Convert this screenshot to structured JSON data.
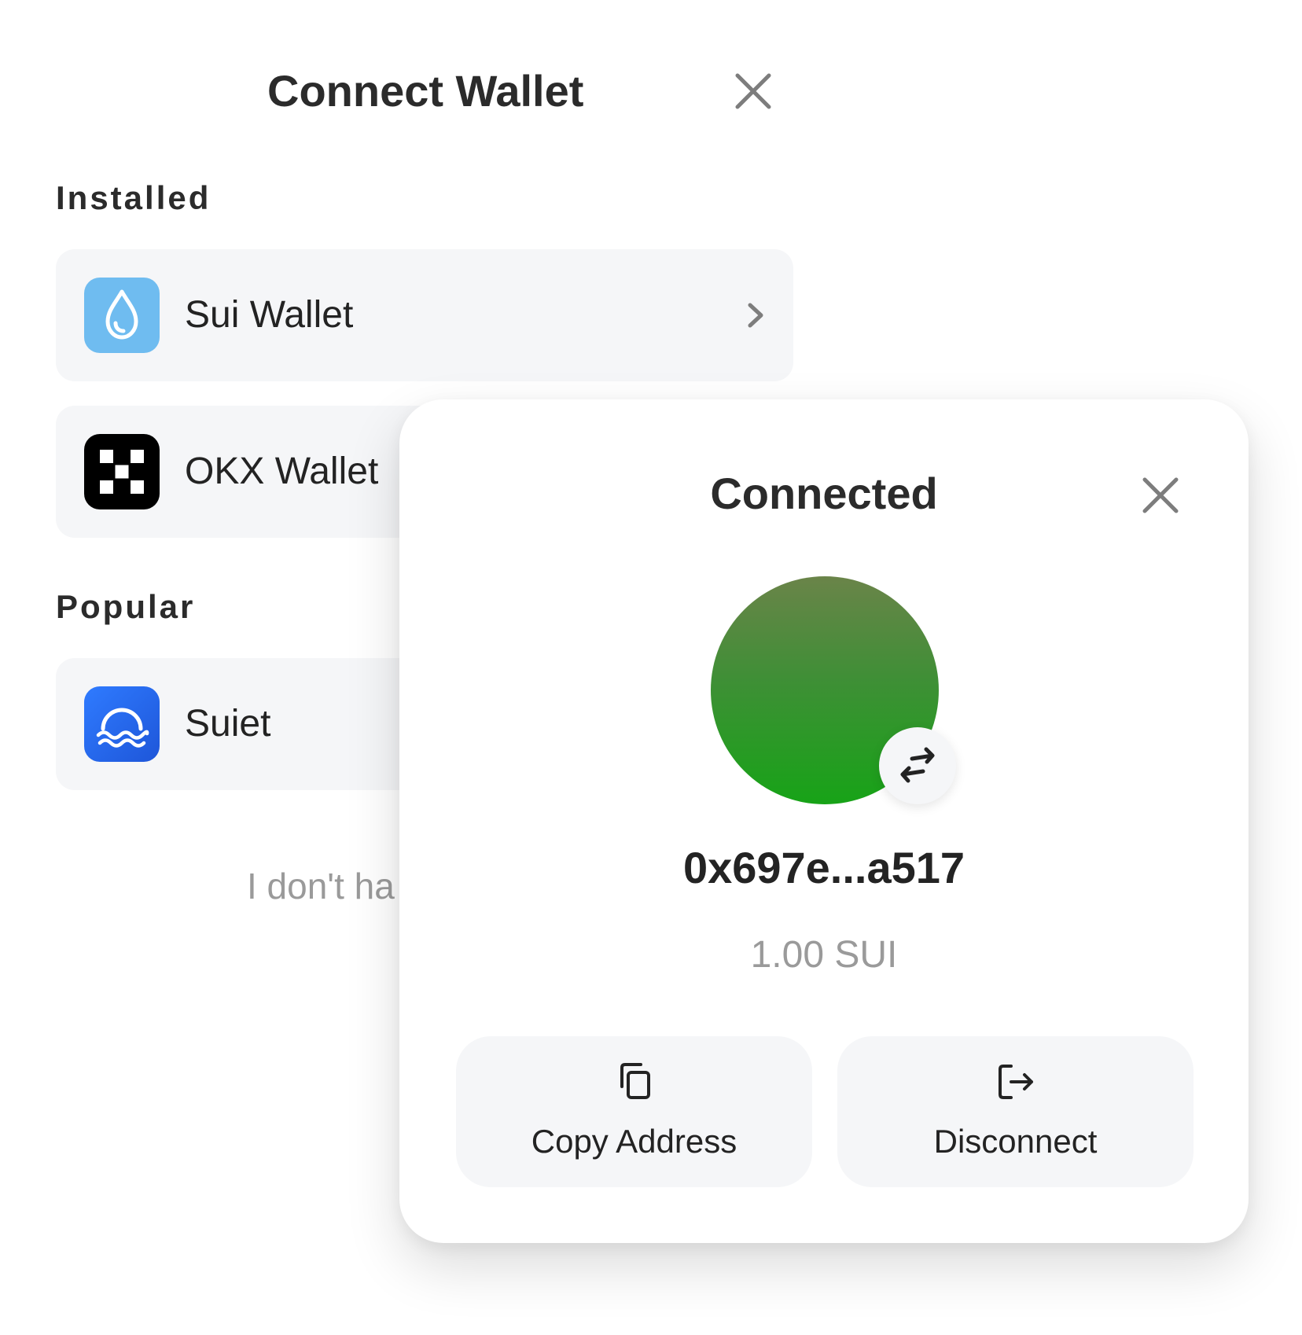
{
  "connect_wallet": {
    "title": "Connect Wallet",
    "close_icon": "close-icon",
    "sections": {
      "installed": {
        "label": "Installed",
        "items": [
          {
            "name": "Sui Wallet",
            "icon": "sui-wallet-logo",
            "chevron": "chevron-right-icon"
          },
          {
            "name": "OKX Wallet",
            "icon": "okx-wallet-logo"
          }
        ]
      },
      "popular": {
        "label": "Popular",
        "items": [
          {
            "name": "Suiet",
            "icon": "suiet-logo"
          }
        ]
      }
    },
    "no_wallet_link": "I don't ha"
  },
  "connected": {
    "title": "Connected",
    "close_icon": "close-icon",
    "avatar": {
      "gradient_top": "#6a8449",
      "gradient_bottom": "#17a317"
    },
    "switch_icon": "switch-arrows-icon",
    "address": "0x697e...a517",
    "balance": "1.00 SUI",
    "actions": [
      {
        "label": "Copy Address",
        "icon": "copy-icon"
      },
      {
        "label": "Disconnect",
        "icon": "logout-icon"
      }
    ]
  },
  "colors": {
    "row_background": "#f5f6f8",
    "text_primary": "#232323",
    "text_muted": "#9a9a9a",
    "sui_blue": "#6fbcf0"
  }
}
